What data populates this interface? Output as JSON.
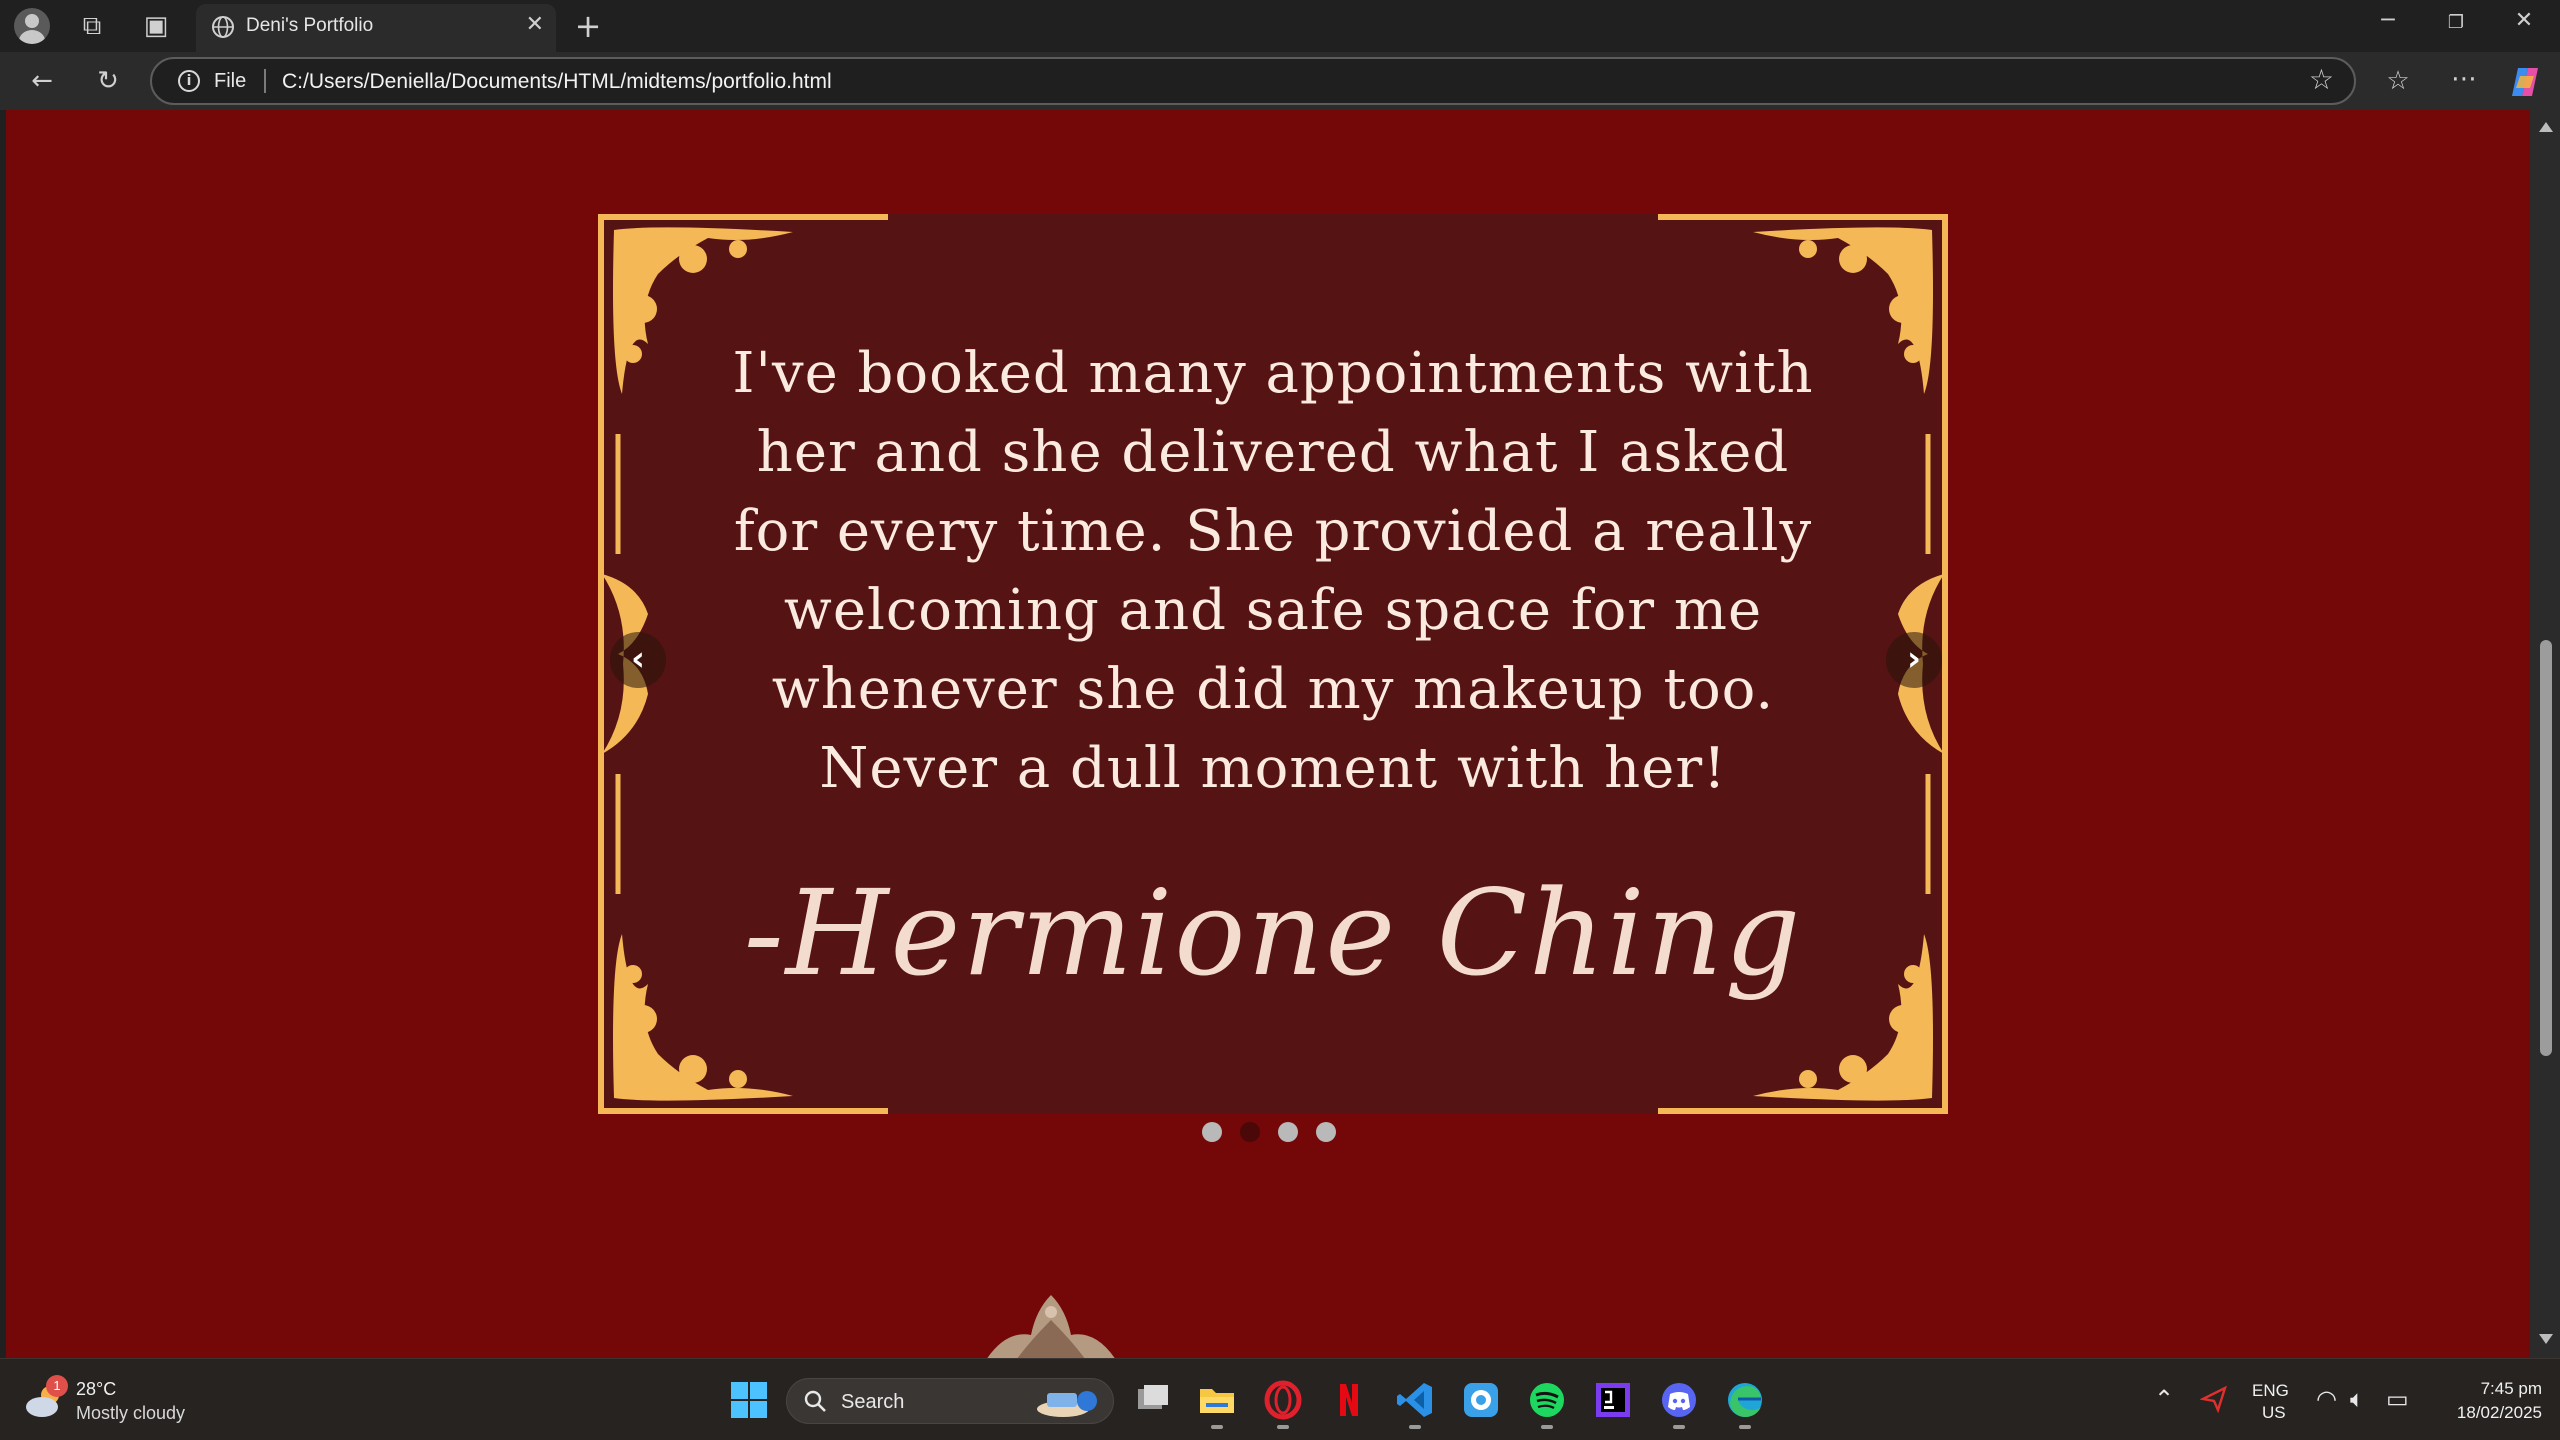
{
  "browser": {
    "tab_title": "Deni's Portfolio",
    "address_scheme_label": "File",
    "url": "C:/Users/Deniella/Documents/HTML/midtems/portfolio.html"
  },
  "testimonial": {
    "quote": "I've booked many appointments with her and she delivered what I asked for every time. She provided a really welcoming and safe space for me whenever she did my makeup too. Never a dull moment with her!",
    "author": "-Hermione Ching",
    "prev_label": "‹",
    "next_label": "›",
    "dots": 4,
    "active_dot": 2
  },
  "taskbar": {
    "weather_badge": "1",
    "temperature": "28°C",
    "condition": "Mostly cloudy",
    "search_label": "Search",
    "language": "ENG",
    "region": "US",
    "time": "7:45 pm",
    "date": "18/02/2025"
  },
  "colors": {
    "page_background": "#740707",
    "frame_background": "#561313",
    "gold": "#f4b857",
    "text": "#fbeadf"
  },
  "icons": {
    "tabbar": [
      "profile-icon",
      "workspaces-icon",
      "vertical-tabs-icon",
      "globe-icon",
      "close-icon",
      "new-tab-icon"
    ],
    "toolbar": [
      "back-icon",
      "refresh-icon",
      "info-icon",
      "favorite-star-icon",
      "favorites-icon",
      "more-icon",
      "copilot-icon"
    ],
    "taskbar_apps": [
      "file-explorer-icon",
      "opera-icon",
      "netflix-icon",
      "vscode-icon",
      "app-icon",
      "spotify-icon",
      "jetbrains-icon",
      "discord-icon",
      "edge-icon"
    ]
  }
}
